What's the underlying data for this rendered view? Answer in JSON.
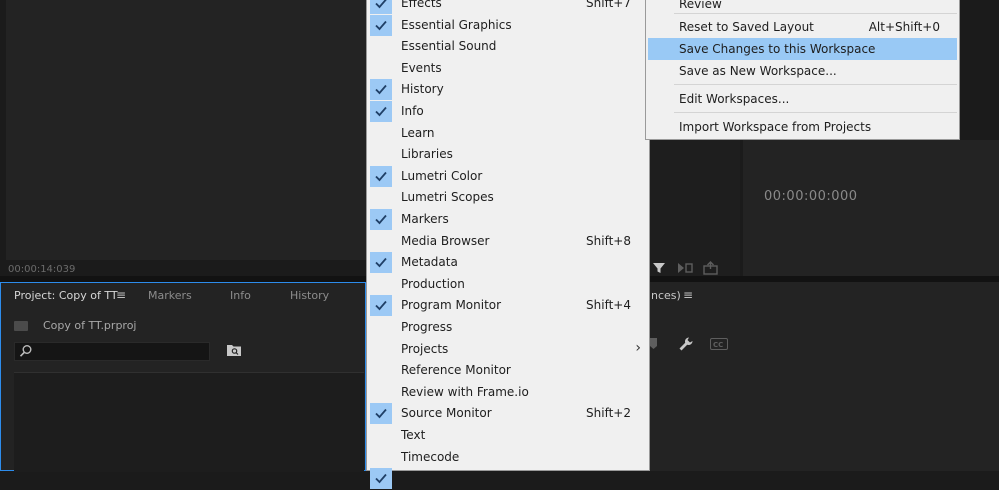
{
  "source_monitor": {
    "timecode": "00:00:14:039"
  },
  "program_monitor": {
    "timecode": "00:00:00:000"
  },
  "project_panel": {
    "tabs": [
      {
        "label": "Project: Copy of TT"
      },
      {
        "label": "Markers"
      },
      {
        "label": "Info"
      },
      {
        "label": "History"
      }
    ],
    "menu_icon": "≡",
    "file_name": "Copy of TT.prproj",
    "search": {
      "value": ""
    }
  },
  "timeline_panel": {
    "tab_fragment": "nces)",
    "menu_icon": "≡"
  },
  "window_menu": {
    "items": [
      {
        "label": "Effects",
        "shortcut": "Shift+7",
        "checked": true
      },
      {
        "label": "Essential Graphics",
        "shortcut": "",
        "checked": true
      },
      {
        "label": "Essential Sound",
        "shortcut": "",
        "checked": false
      },
      {
        "label": "Events",
        "shortcut": "",
        "checked": false
      },
      {
        "label": "History",
        "shortcut": "",
        "checked": true
      },
      {
        "label": "Info",
        "shortcut": "",
        "checked": true
      },
      {
        "label": "Learn",
        "shortcut": "",
        "checked": false
      },
      {
        "label": "Libraries",
        "shortcut": "",
        "checked": false
      },
      {
        "label": "Lumetri Color",
        "shortcut": "",
        "checked": true
      },
      {
        "label": "Lumetri Scopes",
        "shortcut": "",
        "checked": false
      },
      {
        "label": "Markers",
        "shortcut": "",
        "checked": true
      },
      {
        "label": "Media Browser",
        "shortcut": "Shift+8",
        "checked": false
      },
      {
        "label": "Metadata",
        "shortcut": "",
        "checked": true
      },
      {
        "label": "Production",
        "shortcut": "",
        "checked": false
      },
      {
        "label": "Program Monitor",
        "shortcut": "Shift+4",
        "checked": true
      },
      {
        "label": "Progress",
        "shortcut": "",
        "checked": false
      },
      {
        "label": "Projects",
        "shortcut": "",
        "checked": false,
        "submenu": true
      },
      {
        "label": "Reference Monitor",
        "shortcut": "",
        "checked": false
      },
      {
        "label": "Review with Frame.io",
        "shortcut": "",
        "checked": false
      },
      {
        "label": "Source Monitor",
        "shortcut": "Shift+2",
        "checked": true
      },
      {
        "label": "Text",
        "shortcut": "",
        "checked": false
      },
      {
        "label": "Timecode",
        "shortcut": "",
        "checked": false
      },
      {
        "label": "",
        "shortcut": "",
        "checked": true
      }
    ]
  },
  "workspaces_menu": {
    "items": [
      {
        "label": "Review",
        "shortcut": "",
        "highlighted": false
      },
      {
        "label": "Reset to Saved Layout",
        "shortcut": "Alt+Shift+0",
        "highlighted": false
      },
      {
        "label": "Save Changes to this Workspace",
        "shortcut": "",
        "highlighted": true
      },
      {
        "label": "Save as New Workspace...",
        "shortcut": "",
        "highlighted": false
      },
      {
        "label": "Edit Workspaces...",
        "shortcut": "",
        "highlighted": false
      },
      {
        "label": "Import Workspace from Projects",
        "shortcut": "",
        "highlighted": false
      }
    ]
  },
  "colors": {
    "menu_background": "#f0f0f0",
    "highlight": "#99c9f5",
    "panel_focus_border": "#2d8ceb"
  }
}
